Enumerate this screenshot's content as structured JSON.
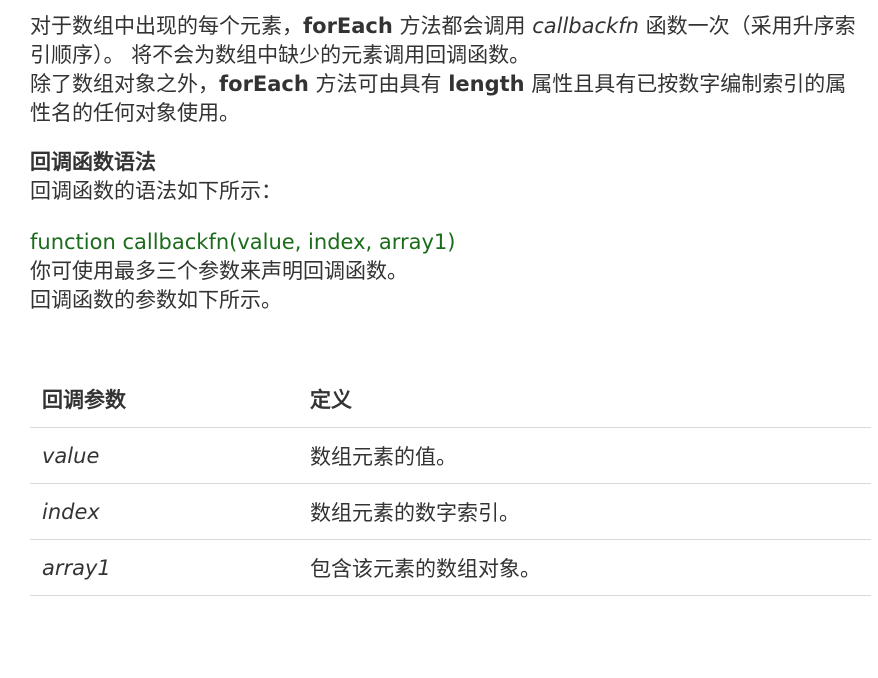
{
  "para1": {
    "t1": "对于数组中出现的每个元素，",
    "b1": "forEach",
    "t2": " 方法都会调用 ",
    "i1": "callbackfn",
    "t3": " 函数一次（采用升序索引顺序）。 将不会为数组中缺少的元素调用回调函数。"
  },
  "para2": {
    "t1": "除了数组对象之外，",
    "b1": "forEach",
    "t2": " 方法可由具有 ",
    "b2": "length",
    "t3": " 属性且具有已按数字编制索引的属性名的任何对象使用。"
  },
  "callback_heading": "回调函数语法",
  "syntax_intro": "回调函数的语法如下所示：",
  "syntax_code": "function callbackfn(value, index, array1)",
  "param_count_note": "你可使用最多三个参数来声明回调函数。",
  "param_intro": "回调函数的参数如下所示。",
  "table": {
    "headers": [
      "回调参数",
      "定义"
    ],
    "rows": [
      {
        "name": "value",
        "definition": "数组元素的值。"
      },
      {
        "name": "index",
        "definition": "数组元素的数字索引。"
      },
      {
        "name": "array1",
        "definition": "包含该元素的数组对象。"
      }
    ]
  },
  "colors": {
    "text": "#333333",
    "code": "#1a6c1a",
    "border": "#d9d9d9"
  }
}
